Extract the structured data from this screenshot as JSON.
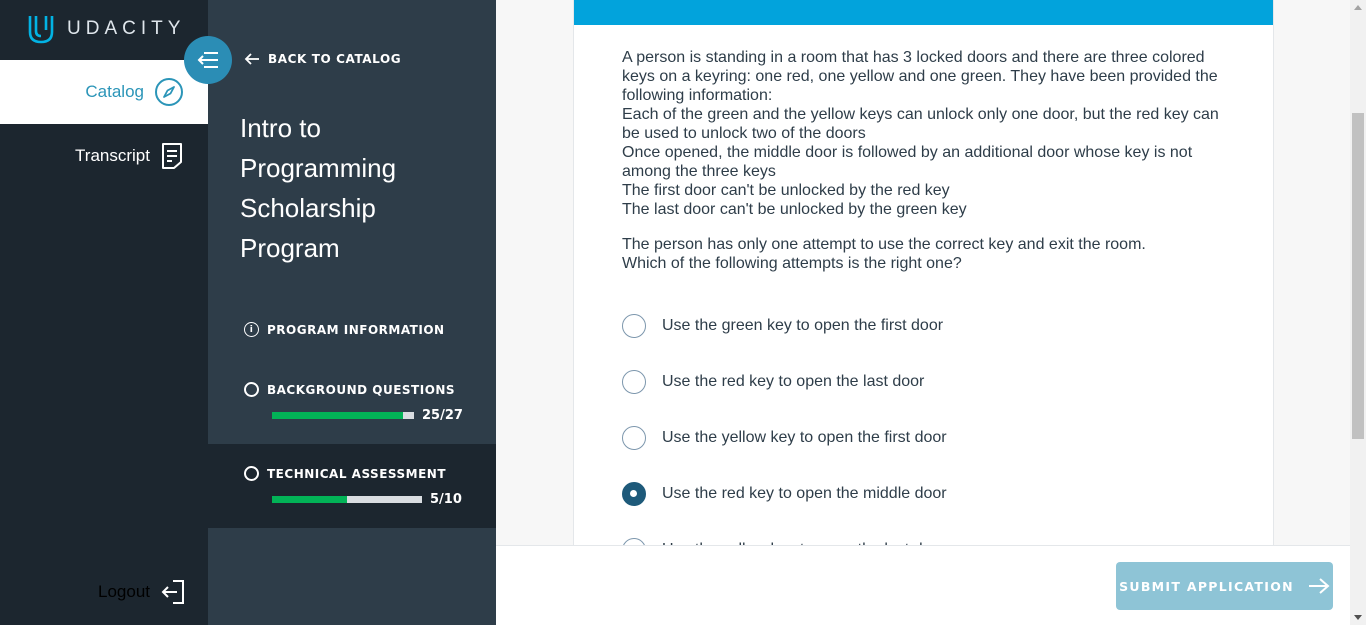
{
  "brand": {
    "name": "UDACITY",
    "logo_icon": "udacity-u-icon"
  },
  "rail": {
    "items": [
      {
        "label": "Catalog",
        "icon": "compass-icon",
        "active": true
      },
      {
        "label": "Transcript",
        "icon": "transcript-icon",
        "active": false
      }
    ],
    "logout_label": "Logout"
  },
  "panel": {
    "back_label": "BACK TO CATALOG",
    "title": "Intro to Programming Scholarship Program",
    "steps": [
      {
        "label": "PROGRAM INFORMATION"
      },
      {
        "label": "BACKGROUND QUESTIONS",
        "count": "25/27",
        "progress": 0.926
      },
      {
        "label": "TECHNICAL ASSESSMENT",
        "count": "5/10",
        "progress": 0.5
      }
    ]
  },
  "question": {
    "lines": [
      "A person is standing in a room that has 3 locked doors and there are three colored keys on a keyring: one red, one yellow and one green. They have been provided the following information:",
      "Each of the green and the yellow keys can unlock only one door, but the red key can be used to unlock two of the doors",
      "Once opened, the middle door is followed by an additional door whose key is not among the three keys",
      "The first door can't be unlocked by the red key",
      "The last door can't be unlocked by the green key"
    ],
    "prompt_lines": [
      "The person has only one attempt to use the correct key and exit the room.",
      "Which of the following attempts is the right one?"
    ],
    "options": [
      {
        "label": "Use the green key to open the first door",
        "selected": false
      },
      {
        "label": "Use the red key to open the last door",
        "selected": false
      },
      {
        "label": "Use the yellow key to open the first door",
        "selected": false
      },
      {
        "label": "Use the red key to open the middle door",
        "selected": true
      },
      {
        "label": "Use the yellow key to open the last door",
        "selected": false
      }
    ]
  },
  "footer": {
    "submit_label": "SUBMIT APPLICATION"
  },
  "colors": {
    "accent": "#02a3dc",
    "progress_green": "#02b357",
    "sidebar_dark": "#1c262f",
    "panel": "#2e3d49",
    "selected_radio": "#1e5a7a"
  }
}
